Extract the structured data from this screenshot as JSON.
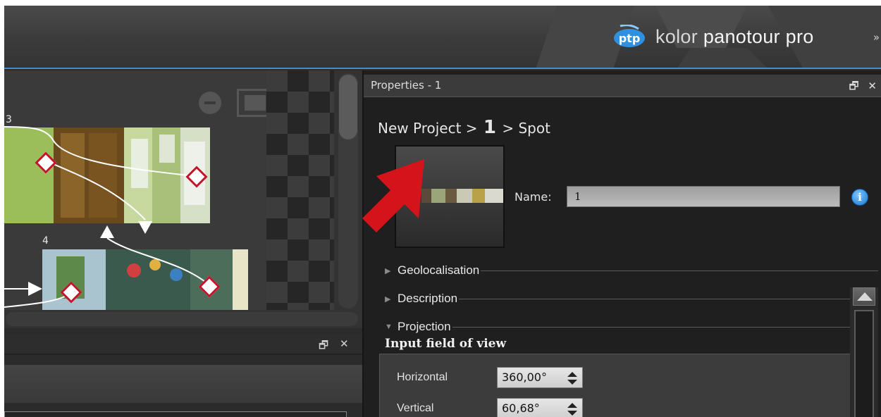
{
  "header": {
    "logo_text": "ptp",
    "brand_prefix": "kolor",
    "brand_name": "panotour pro",
    "expander": "»"
  },
  "tour_graph": {
    "nodes": [
      {
        "label": "3"
      },
      {
        "label": "4"
      }
    ],
    "zoom_out_icon": "minus-circle-icon",
    "fit_icon": "fit-screen-icon",
    "zoom_in_icon": "plus-circle-icon"
  },
  "bottom_panel": {
    "float_icon": "🗗",
    "close_icon": "✕"
  },
  "properties": {
    "title": "Properties - 1",
    "float_icon": "🗗",
    "close_icon": "✕",
    "breadcrumb": {
      "project": "New Project",
      "sep1": ">",
      "item": "1",
      "sep2": ">",
      "type": "Spot"
    },
    "name_label": "Name:",
    "name_value": "1",
    "info_icon": "i",
    "sections": [
      {
        "label": "Geolocalisation",
        "expanded": false
      },
      {
        "label": "Description",
        "expanded": false
      },
      {
        "label": "Projection",
        "expanded": true
      }
    ],
    "input_fov": {
      "title": "Input field of view",
      "horizontal_label": "Horizontal",
      "horizontal_value": "360,00°",
      "vertical_label": "Vertical",
      "vertical_value": "60,68°"
    }
  },
  "annotation": {
    "arrow_color": "#d4141a"
  }
}
